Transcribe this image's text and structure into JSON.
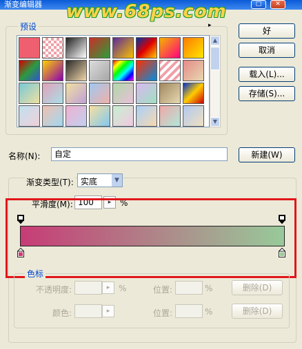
{
  "window": {
    "title": "渐变编辑器",
    "watermark": "www.68ps.com",
    "close_glyph": "✕",
    "max_glyph": "□"
  },
  "presets": {
    "legend": "预设",
    "menu_glyph": "▸",
    "swatches": [
      [
        "#ee6070",
        "checker",
        "#222/#fff",
        "#c83028/#2b9e3a",
        "#5b2a9b/#f7c000",
        "#0032a0/#e00000/#ffcc00",
        "#f6b300/#ff0080",
        "#ff7b00/#ffe600"
      ],
      [
        "#d20000/#2d9a40/#3355cc",
        "#ffd000/#8a00b0",
        "#2a2a2a/#f0d5a8",
        "#dcdcdc/#a6a6a6",
        "rainbow",
        "#ff2e00/#008ee0",
        "stripe",
        "#e68a8a/#e7d8ae"
      ],
      [
        "#78c8d8/#f0e0a0",
        "#e2a0b8/#a8e0e8",
        "#f0e0a0/#c0a0d8",
        "#a0c8f0/#f0b0a8",
        "#b0d8a8/#e8c0d8",
        "#d8b8f0/#a0e0c0",
        "#a08860/#e8d8b0",
        "#0033cc/#ffcc00/#cc0000"
      ],
      [
        "#c0e0f0/#f0d0d8",
        "#f0c0b0/#a0d8f0",
        "#f0b0d0/#c0d0f0",
        "#f8e0a0/#80c8f0",
        "#c8f0d0/#f0c8e0",
        "#a8d0f8/#f8d8b0",
        "#f0a8a8/#b0e8d8",
        "#b0c8f0/#f0e0c0"
      ],
      [
        "#b0e0a0",
        "#c8e0f0",
        "#d8d8d8",
        "#f0d0a0",
        "#c0c0c0",
        "#202020",
        "#f8f8f8",
        "#a0c0e0"
      ]
    ]
  },
  "buttons": {
    "ok": "好",
    "cancel": "取消",
    "load": "载入(L)...",
    "save": "存储(S)...",
    "new": "新建(W)"
  },
  "name": {
    "label": "名称(N):",
    "value": "自定"
  },
  "gradient_type": {
    "label": "渐变类型(T):",
    "value": "实底"
  },
  "smoothness": {
    "label": "平滑度(M):",
    "value": "100",
    "unit": "%"
  },
  "gradient": {
    "start_color": "#c73c76",
    "end_color": "#98ca9a",
    "highlight_color": "#e1161a"
  },
  "color_stops": {
    "legend": "色标",
    "opacity_label": "不透明度:",
    "opacity_unit": "%",
    "location_label_1": "位置:",
    "location_unit_1": "%",
    "delete_label_1": "删除(D)",
    "color_label": "颜色:",
    "location_label_2": "位置:",
    "location_unit_2": "%",
    "delete_label_2": "删除(D)"
  },
  "colors": {
    "accent": "#0046d5",
    "disabled_text": "#aca899"
  }
}
